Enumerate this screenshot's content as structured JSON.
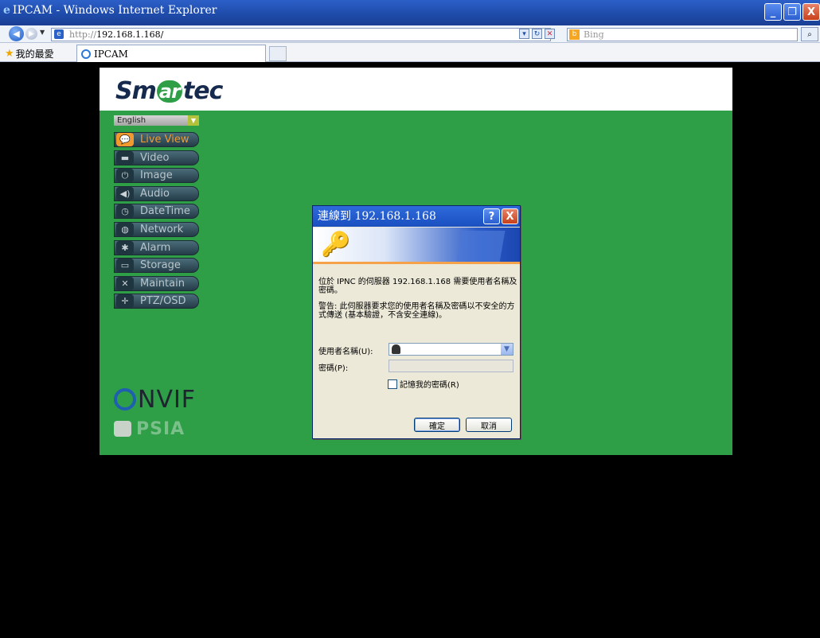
{
  "window": {
    "title": "IPCAM - Windows Internet Explorer",
    "minimize": "_",
    "restore": "❐",
    "close": "X"
  },
  "address": {
    "url_prefix": "http://",
    "url_host": "192.168.1.168/",
    "search_placeholder": "Bing"
  },
  "favorites": {
    "label": "我的最愛",
    "tab_title": "IPCAM"
  },
  "site": {
    "logo_left": "Sm",
    "logo_mid": "ar",
    "logo_right": "tec",
    "language": "English",
    "menu": [
      {
        "label": "Live View",
        "icon": "chat-icon"
      },
      {
        "label": "Video",
        "icon": "camera-icon"
      },
      {
        "label": "Image",
        "icon": "power-icon"
      },
      {
        "label": "Audio",
        "icon": "speaker-icon"
      },
      {
        "label": "DateTime",
        "icon": "clock-icon"
      },
      {
        "label": "Network",
        "icon": "globe-icon"
      },
      {
        "label": "Alarm",
        "icon": "alarm-icon"
      },
      {
        "label": "Storage",
        "icon": "drive-icon"
      },
      {
        "label": "Maintain",
        "icon": "tools-icon"
      },
      {
        "label": "PTZ/OSD",
        "icon": "ptz-icon"
      }
    ],
    "onvif_text": "NVIF",
    "psia_text": "PSIA"
  },
  "dialog": {
    "title": "連線到 192.168.1.168",
    "help": "?",
    "close": "X",
    "message1": "位於 IPNC 的伺服器 192.168.1.168 需要使用者名稱及密碼。",
    "message2": "警告: 此伺服器要求您的使用者名稱及密碼以不安全的方式傳送 (基本驗證，不含安全連線)。",
    "username_label": "使用者名稱(U):",
    "password_label": "密碼(P):",
    "remember_label": "記憶我的密碼(R)",
    "ok": "確定",
    "cancel": "取消"
  }
}
